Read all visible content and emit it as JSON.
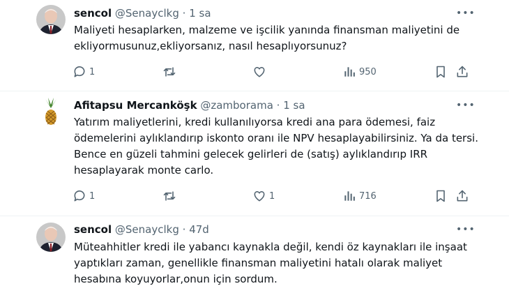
{
  "tweets": [
    {
      "author_name": "sencol",
      "handle": "@Senayclkg",
      "separator": "·",
      "time": "1 sa",
      "more_label": "•••",
      "text": "Maliyeti hesaplarken, malzeme ve işcilik yanında finansman maliyetini de ekliyormusunuz,ekliyorsanız, nasıl hesaplıyorsunuz?",
      "reply_count": "1",
      "retweet_count": "",
      "like_count": "",
      "view_count": "950",
      "icons": [
        "reply-icon",
        "retweet-icon",
        "like-icon",
        "views-icon",
        "bookmark-icon",
        "share-icon"
      ]
    },
    {
      "author_name": "Afitapsu Mercanköşk",
      "handle": "@zamborama",
      "separator": "·",
      "time": "1 sa",
      "more_label": "•••",
      "text": "Yatırım maliyetlerini, kredi kullanılıyorsa kredi ana para ödemesi, faiz ödemelerini aylıklandırıp iskonto oranı ile NPV hesaplayabilirsiniz. Ya da tersi. Bence en güzeli tahmini gelecek gelirleri de (satış) aylıklandırıp IRR hesaplayarak monte carlo.",
      "reply_count": "1",
      "retweet_count": "",
      "like_count": "1",
      "view_count": "716",
      "icons": [
        "reply-icon",
        "retweet-icon",
        "like-icon",
        "views-icon",
        "bookmark-icon",
        "share-icon"
      ]
    },
    {
      "author_name": "sencol",
      "handle": "@Senayclkg",
      "separator": "·",
      "time": "47d",
      "more_label": "•••",
      "text": "Müteahhitler kredi ile  yabancı kaynakla değil, kendi öz kaynakları ile inşaat yaptıkları zaman, genellikle finansman maliyetini hatalı olarak maliyet hesabına koyuyorlar,onun için sordum."
    }
  ]
}
